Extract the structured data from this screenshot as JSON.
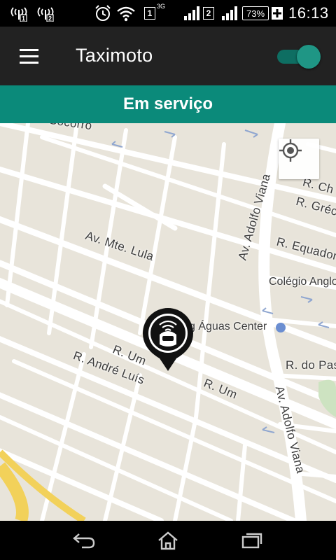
{
  "status_bar": {
    "sim1_label": "1",
    "sim1_network": "3G",
    "sim2_label": "2",
    "battery": "73%",
    "time": "16:13",
    "icons": [
      "signal-sim1-icon",
      "signal-sim2-icon",
      "alarm-icon",
      "wifi-icon",
      "sim1-icon",
      "cell-bars-icon",
      "sim2-icon",
      "cell-bars-icon",
      "battery-icon",
      "charging-icon"
    ]
  },
  "app_bar": {
    "title": "Taximoto",
    "menu_icon": "menu-icon",
    "toggle_on": true,
    "accent_color": "#0b8a7a"
  },
  "service_status": {
    "text": "Em serviço"
  },
  "map": {
    "streets": {
      "socorro": "Socorro",
      "mte_lula": "Av. Mte. Lula",
      "adolfo_viana_top": "Av. Adolfo Viana",
      "adolfo_viana_bottom": "Av. Adolfo Viana",
      "ch": "R. Ch",
      "grec": "R. Grécı",
      "equador": "R. Equador",
      "um_left": "R. Um",
      "um_right": "R. Um",
      "andre_luis": "R. André Luís",
      "do_pas": "R. do Pas"
    },
    "pois": {
      "colegio": "Colégio Anglo",
      "aguas_center": "g Águas Center"
    },
    "locate_icon": "my-location-icon",
    "marker_icon": "motorcycle-helmet-marker-icon"
  },
  "nav_bar": {
    "icons": [
      "back-icon",
      "home-icon",
      "recent-apps-icon"
    ]
  }
}
